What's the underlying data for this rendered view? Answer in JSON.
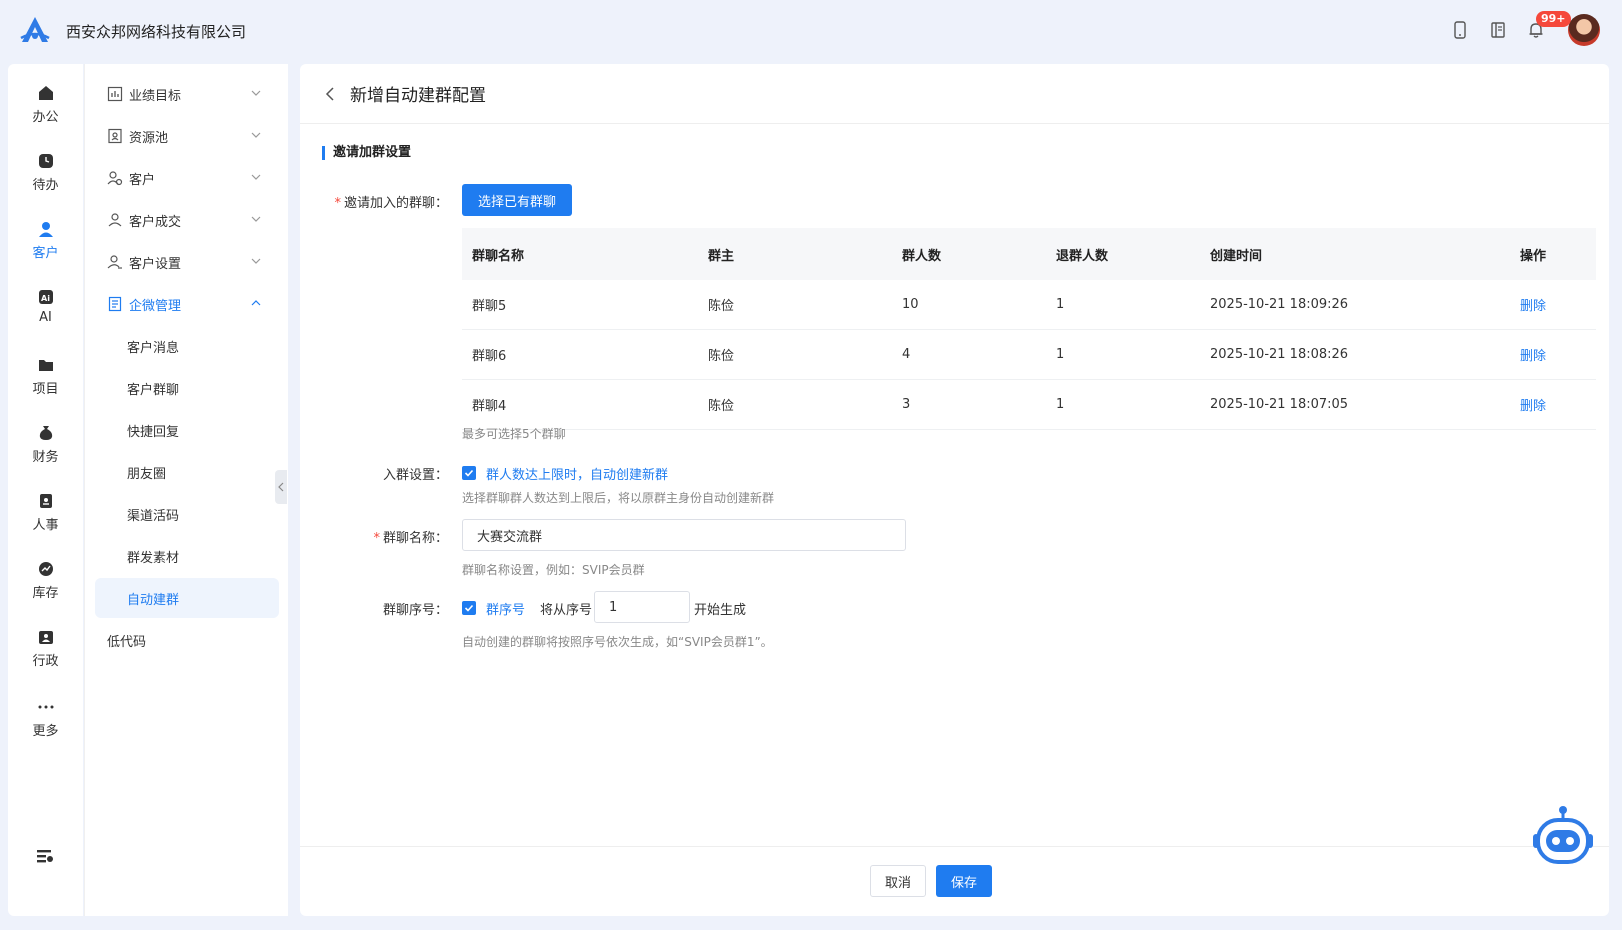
{
  "header": {
    "company": "西安众邦网络科技有限公司",
    "notification_badge": "99+"
  },
  "rail": {
    "items": [
      {
        "label": "办公",
        "icon": "home-icon"
      },
      {
        "label": "待办",
        "icon": "clock-icon"
      },
      {
        "label": "客户",
        "icon": "customer-icon",
        "active": true
      },
      {
        "label": "AI",
        "icon": "ai-icon"
      },
      {
        "label": "项目",
        "icon": "folder-icon"
      },
      {
        "label": "财务",
        "icon": "money-bag-icon"
      },
      {
        "label": "人事",
        "icon": "badge-icon"
      },
      {
        "label": "库存",
        "icon": "chart-icon"
      },
      {
        "label": "行政",
        "icon": "admin-icon"
      },
      {
        "label": "更多",
        "icon": "more-icon"
      }
    ]
  },
  "submenu": {
    "items": [
      {
        "label": "业绩目标"
      },
      {
        "label": "资源池"
      },
      {
        "label": "客户"
      },
      {
        "label": "客户成交"
      },
      {
        "label": "客户设置"
      },
      {
        "label": "企微管理"
      },
      {
        "label": "客户消息"
      },
      {
        "label": "客户群聊"
      },
      {
        "label": "快捷回复"
      },
      {
        "label": "朋友圈"
      },
      {
        "label": "渠道活码"
      },
      {
        "label": "群发素材"
      },
      {
        "label": "自动建群"
      },
      {
        "label": "低代码"
      }
    ]
  },
  "page": {
    "title": "新增自动建群配置",
    "section_title": "邀请加群设置",
    "invite_label": "邀请加入的群聊：",
    "select_button": "选择已有群聊",
    "table": {
      "headers": [
        "群聊名称",
        "群主",
        "群人数",
        "退群人数",
        "创建时间",
        "操作"
      ],
      "rows": [
        [
          "群聊5",
          "陈俭",
          "10",
          "1",
          "2025-10-21 18:09:26",
          "删除"
        ],
        [
          "群聊6",
          "陈俭",
          "4",
          "1",
          "2025-10-21 18:08:26",
          "删除"
        ],
        [
          "群聊4",
          "陈俭",
          "3",
          "1",
          "2025-10-21 18:07:05",
          "删除"
        ]
      ]
    },
    "max_hint": "最多可选择5个群聊",
    "join_label": "入群设置：",
    "join_checkbox": "群人数达上限时，自动创建新群",
    "join_hint": "选择群聊群人数达到上限后，将以原群主身份自动创建新群",
    "name_label": "群聊名称：",
    "name_value": "大赛交流群",
    "name_hint": "群聊名称设置，例如：SVIP会员群",
    "seq_label": "群聊序号：",
    "seq_checkbox": "群序号",
    "seq_from": "将从序号",
    "seq_value": "1",
    "seq_start": "开始生成",
    "seq_hint": "自动创建的群聊将按照序号依次生成，如“SVIP会员群1”。",
    "cancel": "取消",
    "save": "保存"
  }
}
